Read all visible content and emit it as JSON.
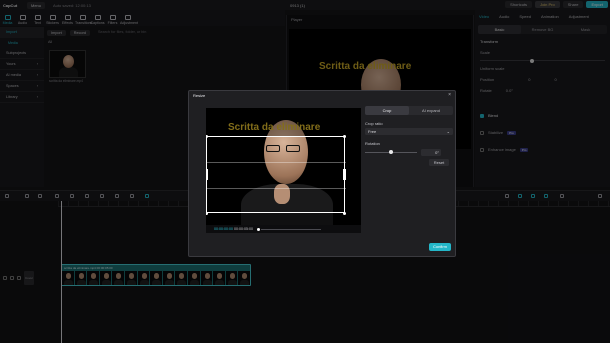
{
  "titlebar": {
    "logo": "CapCut",
    "menu": "Menu",
    "autosave": "Auto saved: 12:00:13",
    "project": "0913 (1)",
    "shortcuts": "Shortcuts",
    "join_pro": "Join Pro",
    "share": "Share",
    "export": "Export"
  },
  "toolbar": {
    "items": [
      "Media",
      "Audio",
      "Text",
      "Stickers",
      "Effects",
      "Transitions",
      "Captions",
      "Filters",
      "Adjustment"
    ]
  },
  "leftnav": {
    "import": "Import",
    "items": [
      "Media",
      "Subprojects",
      "Yours",
      "AI media",
      "Spaces",
      "Library"
    ],
    "sub": "Media"
  },
  "media": {
    "import_tab": "Import",
    "record_tab": "Record",
    "search_placeholder": "Search for files, folder, or bin",
    "all": "All",
    "thumb_label": "Added",
    "thumb_file": "scritta da eliminare.mp4"
  },
  "player": {
    "label": "Player",
    "overlay_text": "Scritta da eliminare"
  },
  "rightpanel": {
    "tabs": [
      "Video",
      "Audio",
      "Speed",
      "Animation",
      "Adjustment"
    ],
    "subtabs": [
      "Basic",
      "Remove BG",
      "Mask"
    ],
    "transform": "Transform",
    "scale": "Scale",
    "uniform_scale": "Uniform scale",
    "position": "Position",
    "position_x": "0",
    "position_y": "0",
    "rotate": "Rotate",
    "rotate_val": "0.0°",
    "blend": "Blend",
    "stabilize": "Stabilize",
    "enhance_image": "Enhance image",
    "badge": "Pro"
  },
  "timeline": {
    "cover": "Cover",
    "clip_label": "scritta da eliminare.mp4   00:00:05:00"
  },
  "modal": {
    "title": "Resize",
    "close": "×",
    "canvas_text": "Scritta da eliminare",
    "seg_crop": "Crop",
    "seg_ai": "AI expand",
    "crop_ratio_label": "Crop ratio",
    "crop_ratio_value": "Free",
    "rotation_label": "Rotation",
    "rotation_value": "0°",
    "rotation_fraction": 0.5,
    "reset": "Reset",
    "time_current": "00:00:00:00",
    "time_total": "00:00:05:00",
    "confirm": "Confirm"
  },
  "colors": {
    "accent": "#24b7c9",
    "overlay_text": "#c8a828",
    "clip": "#1d6f72"
  }
}
